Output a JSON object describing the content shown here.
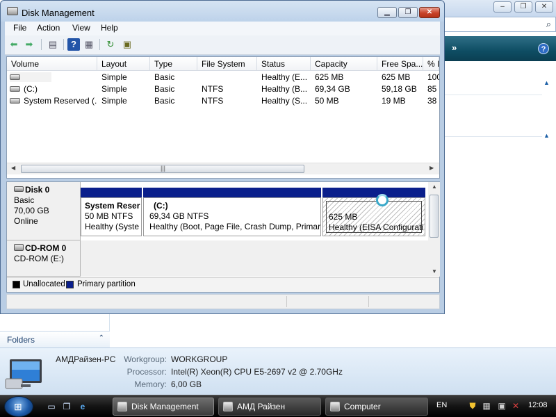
{
  "disk_management": {
    "title": "Disk Management",
    "menu": [
      "File",
      "Action",
      "View",
      "Help"
    ],
    "columns": [
      "Volume",
      "Layout",
      "Type",
      "File System",
      "Status",
      "Capacity",
      "Free Spa...",
      "% F"
    ],
    "volumes": [
      {
        "volume": "",
        "layout": "Simple",
        "type": "Basic",
        "fs": "",
        "status": "Healthy (E...",
        "capacity": "625 MB",
        "free": "625 MB",
        "pct": "100"
      },
      {
        "volume": "(C:)",
        "layout": "Simple",
        "type": "Basic",
        "fs": "NTFS",
        "status": "Healthy (B...",
        "capacity": "69,34 GB",
        "free": "59,18 GB",
        "pct": "85"
      },
      {
        "volume": "System Reserved (...",
        "layout": "Simple",
        "type": "Basic",
        "fs": "NTFS",
        "status": "Healthy (S...",
        "capacity": "50 MB",
        "free": "19 MB",
        "pct": "38"
      }
    ],
    "disks": [
      {
        "name": "Disk 0",
        "type": "Basic",
        "size": "70,00 GB",
        "state": "Online",
        "partitions": [
          {
            "name": "System Reser",
            "size": "50 MB NTFS",
            "status": "Healthy (Syste"
          },
          {
            "name": "(C:)",
            "size": "69,34 GB NTFS",
            "status": "Healthy (Boot, Page File, Crash Dump, Primar"
          },
          {
            "name": "",
            "size": "625 MB",
            "status": "Healthy (EISA Configurati"
          }
        ]
      },
      {
        "name": "CD-ROM 0",
        "type": "CD-ROM (E:)"
      }
    ],
    "legend": [
      {
        "label": "Unallocated",
        "color": "#000000"
      },
      {
        "label": "Primary partition",
        "color": "#0a1f8c"
      }
    ]
  },
  "details": {
    "computer_name": "АМДРайзен-PC",
    "workgroup_label": "Workgroup:",
    "workgroup": "WORKGROUP",
    "processor_label": "Processor:",
    "processor": "Intel(R) Xeon(R) CPU E5-2697 v2 @ 2.70GHz",
    "memory_label": "Memory:",
    "memory": "6,00 GB"
  },
  "left_pane": {
    "folders": "Folders"
  },
  "taskbar": {
    "buttons": [
      "Disk Management",
      "АМД Райзен",
      "Computer"
    ],
    "language": "EN",
    "time": "12:08"
  }
}
